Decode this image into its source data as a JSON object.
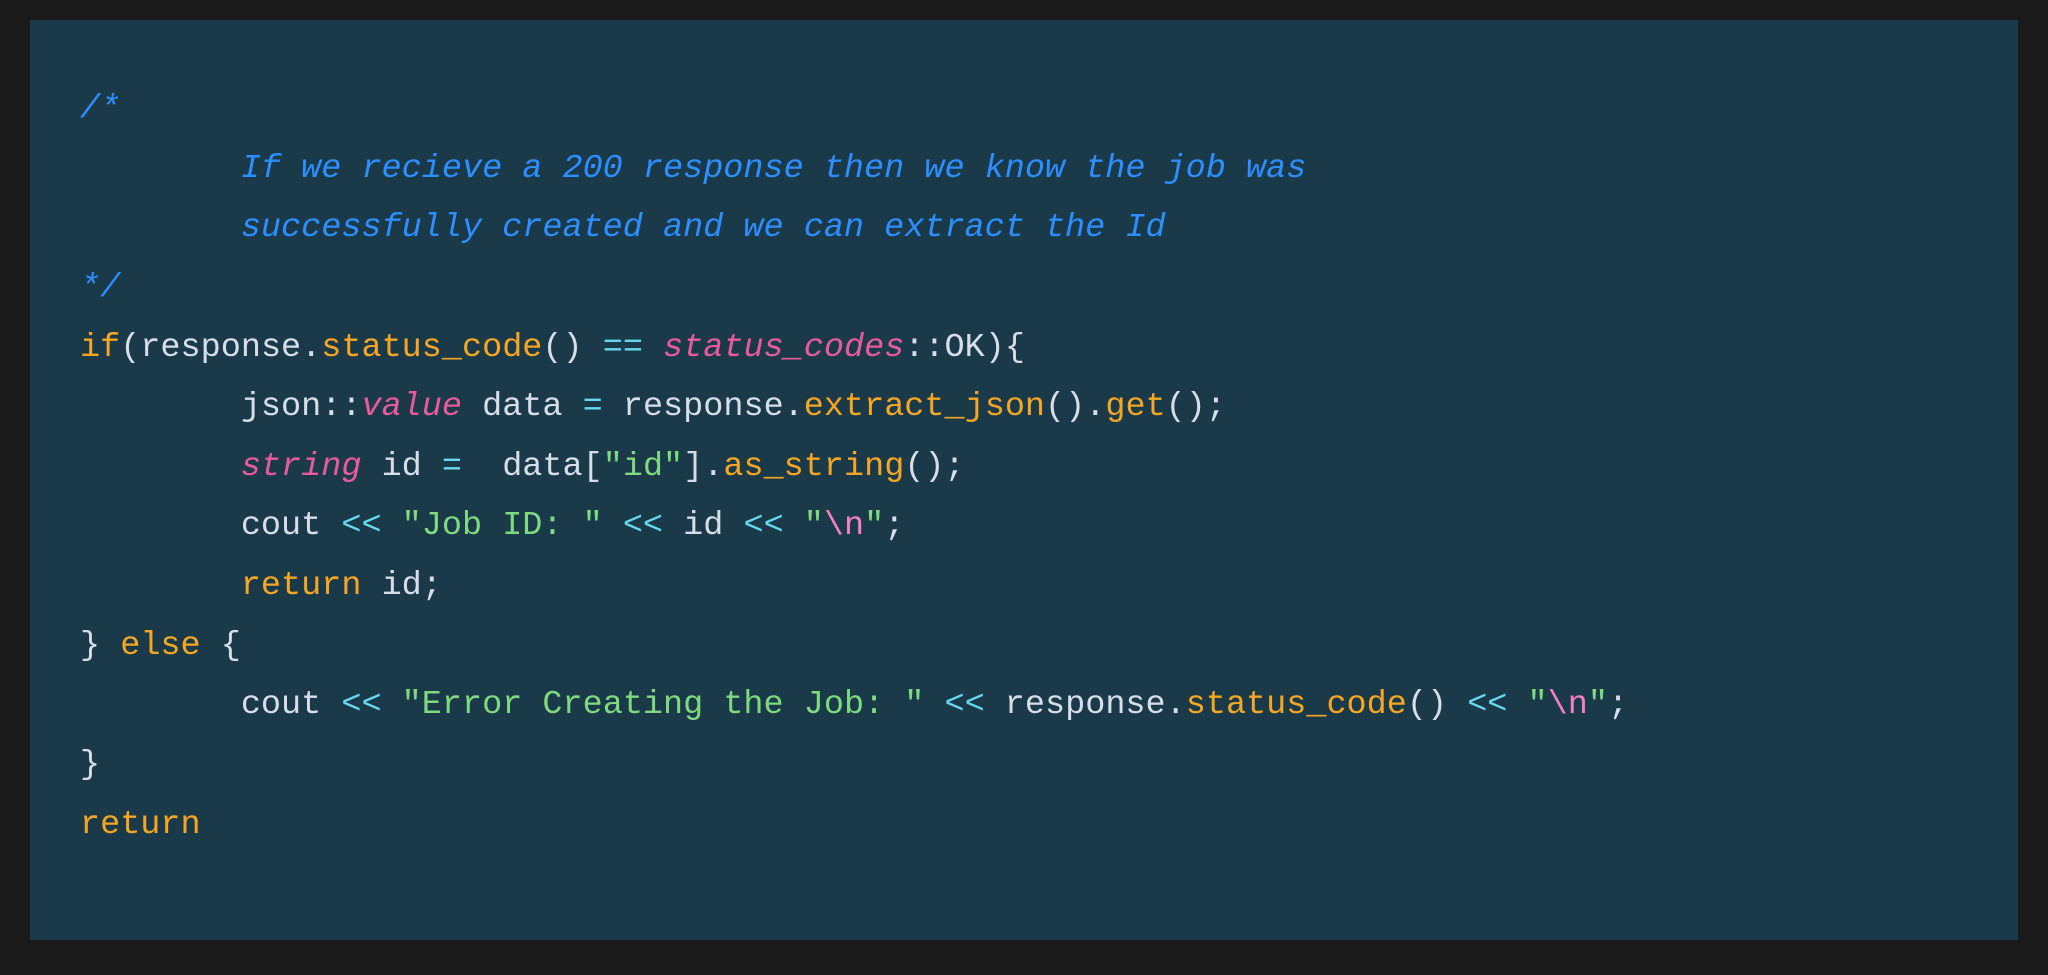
{
  "code": {
    "comment_open": "/*",
    "comment_line1": "        If we recieve a 200 response then we know the job was",
    "comment_line2": "        successfully created and we can extract the Id",
    "comment_close": "*/",
    "kw_if": "if",
    "lpar1": "(",
    "resp1": "response",
    "dot1": ".",
    "status_code1": "status_code",
    "call_parens1": "()",
    "sp1": " ",
    "eqeq": "==",
    "sp2": " ",
    "status_codes_t": "status_codes",
    "dcolon": "::",
    "ok_const": "OK",
    "rpar_brace": "){",
    "indent": "        ",
    "json_ns": "json",
    "dcolon2": "::",
    "value_t": "value",
    "sp3": " ",
    "data_id": "data",
    "sp_eq_sp": " = ",
    "resp2": "response",
    "dot2": ".",
    "extract_json": "extract_json",
    "call_parens2": "()",
    "dot3": ".",
    "get_call": "get",
    "call_parens3": "()",
    "semi": ";",
    "string_t": "string",
    "sp4": " ",
    "id_ident": "id",
    "sp_eq_sp2": " =  ",
    "data_ref": "data",
    "lbracket": "[",
    "id_str": "\"id\"",
    "rbracket": "]",
    "dot4": ".",
    "as_string": "as_string",
    "call_parens4": "()",
    "cout1": "cout",
    "lshift1": " << ",
    "jobid_str_open": "\"",
    "jobid_str": "Job ID: ",
    "jobid_str_close": "\"",
    "lshift2": " << ",
    "id_ref": "id",
    "lshift3": " << ",
    "nl_q1": "\"",
    "nl_esc1": "\\n",
    "nl_q2": "\"",
    "kw_return1": "return",
    "sp5": " ",
    "id_ret": "id",
    "rbrace": "}",
    "sp6": " ",
    "kw_else": "else",
    "sp7": " ",
    "lbrace2": "{",
    "cout2": "cout",
    "lshift4": " << ",
    "err_str_open": "\"",
    "err_str": "Error Creating the Job: ",
    "err_str_close": "\"",
    "lshift5": " << ",
    "resp3": "response",
    "dot5": ".",
    "status_code2": "status_code",
    "call_parens5": "()",
    "lshift6": " << ",
    "nl_q3": "\"",
    "nl_esc2": "\\n",
    "nl_q4": "\"",
    "rbrace2": "}",
    "kw_return2": "return"
  }
}
